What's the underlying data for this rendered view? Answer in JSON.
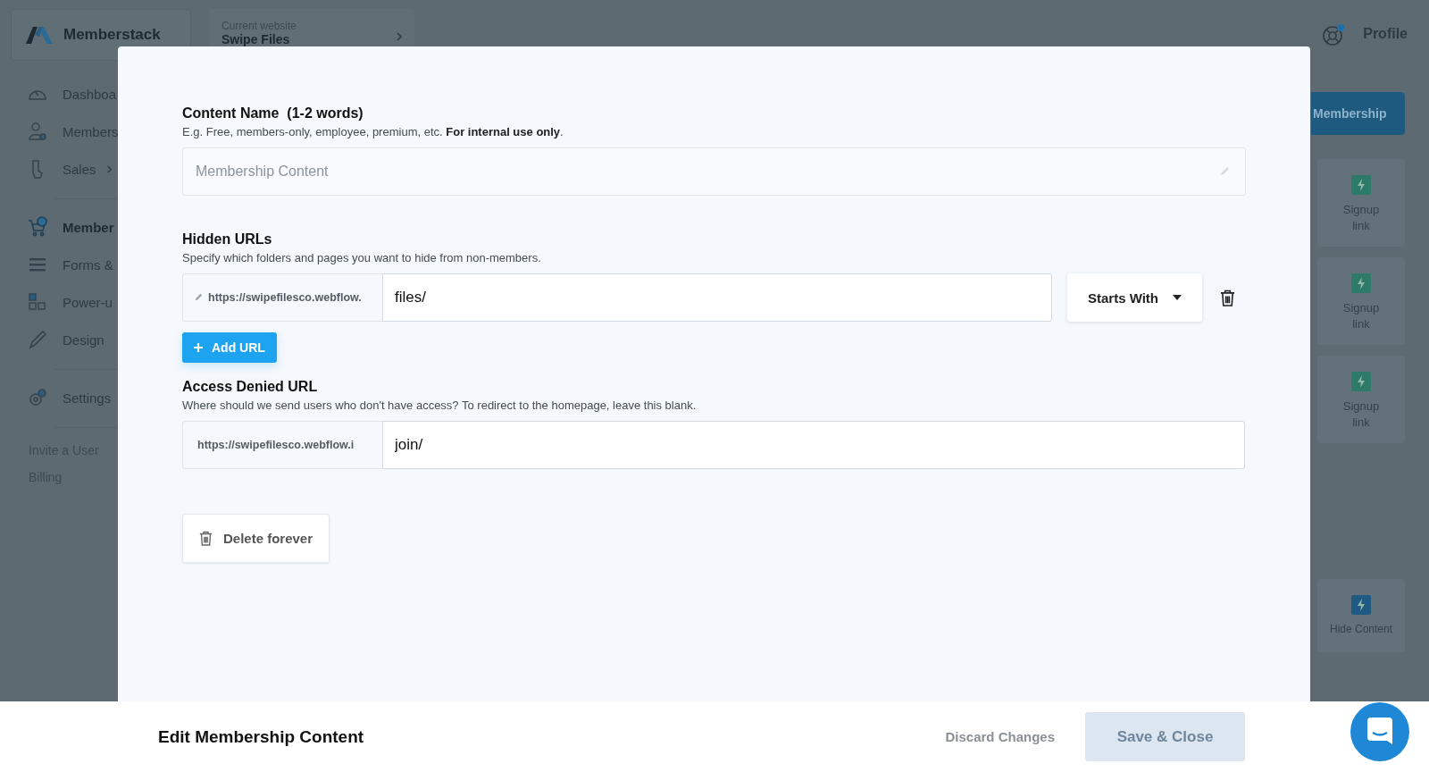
{
  "header": {
    "brand": "Memberstack",
    "website_label": "Current website",
    "website_name": "Swipe Files",
    "profile": "Profile",
    "notification": true
  },
  "sidebar": {
    "nav": [
      {
        "label": "Dashboa",
        "selected": false,
        "expandable": false
      },
      {
        "label": "Members",
        "selected": false,
        "expandable": false
      },
      {
        "label": "Sales",
        "selected": false,
        "expandable": true
      },
      {
        "label": "Member",
        "selected": true,
        "expandable": false
      },
      {
        "label": "Forms &",
        "selected": false,
        "expandable": false
      },
      {
        "label": "Power-u",
        "selected": false,
        "expandable": false
      },
      {
        "label": "Design",
        "selected": false,
        "expandable": false
      },
      {
        "label": "Settings",
        "selected": false,
        "expandable": false
      }
    ],
    "links": [
      "Invite a User",
      "Billing"
    ]
  },
  "right_panel": {
    "membership_button": "Membership",
    "blocks": [
      {
        "label": "Signup link",
        "color": "#2e7a68"
      },
      {
        "label": "Signup link",
        "color": "#2e7a68"
      },
      {
        "label": "Signup link",
        "color": "#2e7a68"
      },
      {
        "label": "Hide Content",
        "color": "#1f5a82"
      }
    ]
  },
  "modal": {
    "content_name": {
      "label": "Content Name  (1-2 words)",
      "hint": "E.g. Free, members-only, employee, premium, etc. **For internal use only**.",
      "placeholder": "Membership Content"
    },
    "hidden_urls": {
      "label": "Hidden URLs",
      "hint": "Specify which folders and pages you want to hide from non-members.",
      "rows": [
        {
          "prefix": "https://swipefilesco.webflow.",
          "value": "files/",
          "match": "Starts With"
        }
      ],
      "add_button": "Add URL"
    },
    "access_denied": {
      "label": "Access Denied URL",
      "hint": "Where should we send users who don't have access? To redirect to the homepage, leave this blank.",
      "prefix": "https://swipefilesco.webflow.i",
      "value": "join/"
    },
    "delete_button": "Delete forever"
  },
  "footer": {
    "title": "Edit Membership Content",
    "discard": "Discard Changes",
    "save": "Save & Close",
    "save_disabled": true
  }
}
